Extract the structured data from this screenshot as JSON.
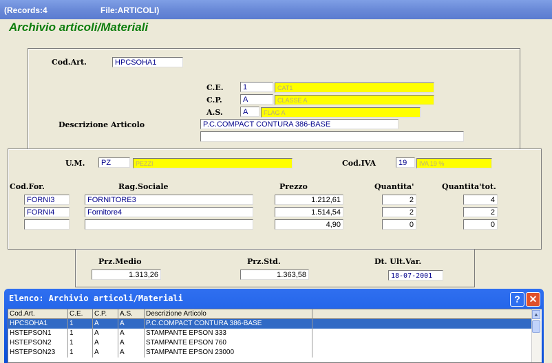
{
  "window": {
    "records_label": "(Records:4",
    "file_label": "File:ARTICOLI)"
  },
  "heading": "Archivio articoli/Materiali",
  "article": {
    "cod_art_label": "Cod.Art.",
    "cod_art_value": "HPCSOHA1",
    "ce_label": "C.E.",
    "ce_value": "1",
    "ce_desc": "CAT1",
    "cp_label": "C.P.",
    "cp_value": "A",
    "cp_desc": "CLASSE A",
    "as_label": "A.S.",
    "as_value": "A",
    "as_desc": "FLAG A",
    "descr_label": "Descrizione Articolo",
    "descr_value": "P.C.COMPACT CONTURA 386-BASE",
    "descr_value2": ""
  },
  "supply": {
    "um_label": "U.M.",
    "um_value": "PZ",
    "um_desc": "PEZZI",
    "iva_label": "Cod.IVA",
    "iva_value": "19",
    "iva_desc": "IVA 19 %",
    "col_codfor": "Cod.For.",
    "col_rag": "Rag.Sociale",
    "col_prezzo": "Prezzo",
    "col_qta": "Quantita'",
    "col_qtatot": "Quantita'tot.",
    "rows": [
      {
        "codfor": "FORNI3",
        "rag": "FORNITORE3",
        "prezzo": "1.212,61",
        "qta": "2",
        "qtatot": "4"
      },
      {
        "codfor": "FORNI4",
        "rag": "Fornitore4",
        "prezzo": "1.514,54",
        "qta": "2",
        "qtatot": "2"
      },
      {
        "codfor": "",
        "rag": "",
        "prezzo": "4,90",
        "qta": "0",
        "qtatot": "0"
      }
    ]
  },
  "prices": {
    "medio_label": "Prz.Medio",
    "medio_value": "1.313,26",
    "std_label": "Prz.Std.",
    "std_value": "1.363,58",
    "dt_label": "Dt. Ult.Var.",
    "dt_value": "18-07-2001"
  },
  "dialog": {
    "title": "Elenco: Archivio articoli/Materiali",
    "help_glyph": "?",
    "close_glyph": "✕",
    "columns": [
      "Cod.Art.",
      "C.E.",
      "C.P.",
      "A.S.",
      "Descrizione Articolo",
      ""
    ],
    "rows": [
      [
        "HPCSOHA1",
        "1",
        "A",
        "A",
        "P.C.COMPACT CONTURA 386-BASE"
      ],
      [
        "HSTEPSON1",
        "1",
        "A",
        "A",
        "STAMPANTE EPSON 333"
      ],
      [
        "HSTEPSON2",
        "1",
        "A",
        "A",
        "STAMPANTE EPSON 760"
      ],
      [
        "HSTEPSON23",
        "1",
        "A",
        "A",
        "STAMPANTE EPSON 23000"
      ]
    ],
    "selected_row": 0
  },
  "colors": {
    "heading": "#0e7e0e",
    "field_text": "#00008b",
    "lookup_bg": "#ffff00",
    "selection": "#316ac5"
  }
}
